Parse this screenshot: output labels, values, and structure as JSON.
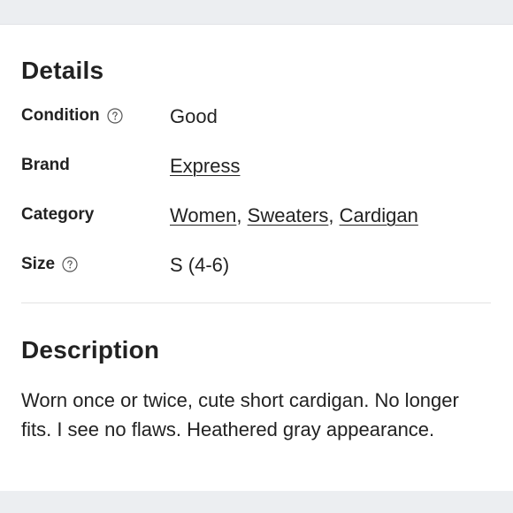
{
  "details": {
    "title": "Details",
    "rows": {
      "condition": {
        "label": "Condition",
        "value": "Good",
        "has_help": true
      },
      "brand": {
        "label": "Brand",
        "value": "Express"
      },
      "category": {
        "label": "Category",
        "links": [
          "Women",
          "Sweaters",
          "Cardigan"
        ],
        "separator": ", "
      },
      "size": {
        "label": "Size",
        "value": "S (4-6)",
        "has_help": true
      }
    }
  },
  "description": {
    "title": "Description",
    "text": "Worn once or twice, cute short cardigan. No longer fits. I see no flaws. Heathered gray appearance."
  },
  "icons": {
    "help": "question-circle-icon"
  },
  "colors": {
    "text": "#222222",
    "band": "#eceef1",
    "divider": "#e3e3e3"
  }
}
